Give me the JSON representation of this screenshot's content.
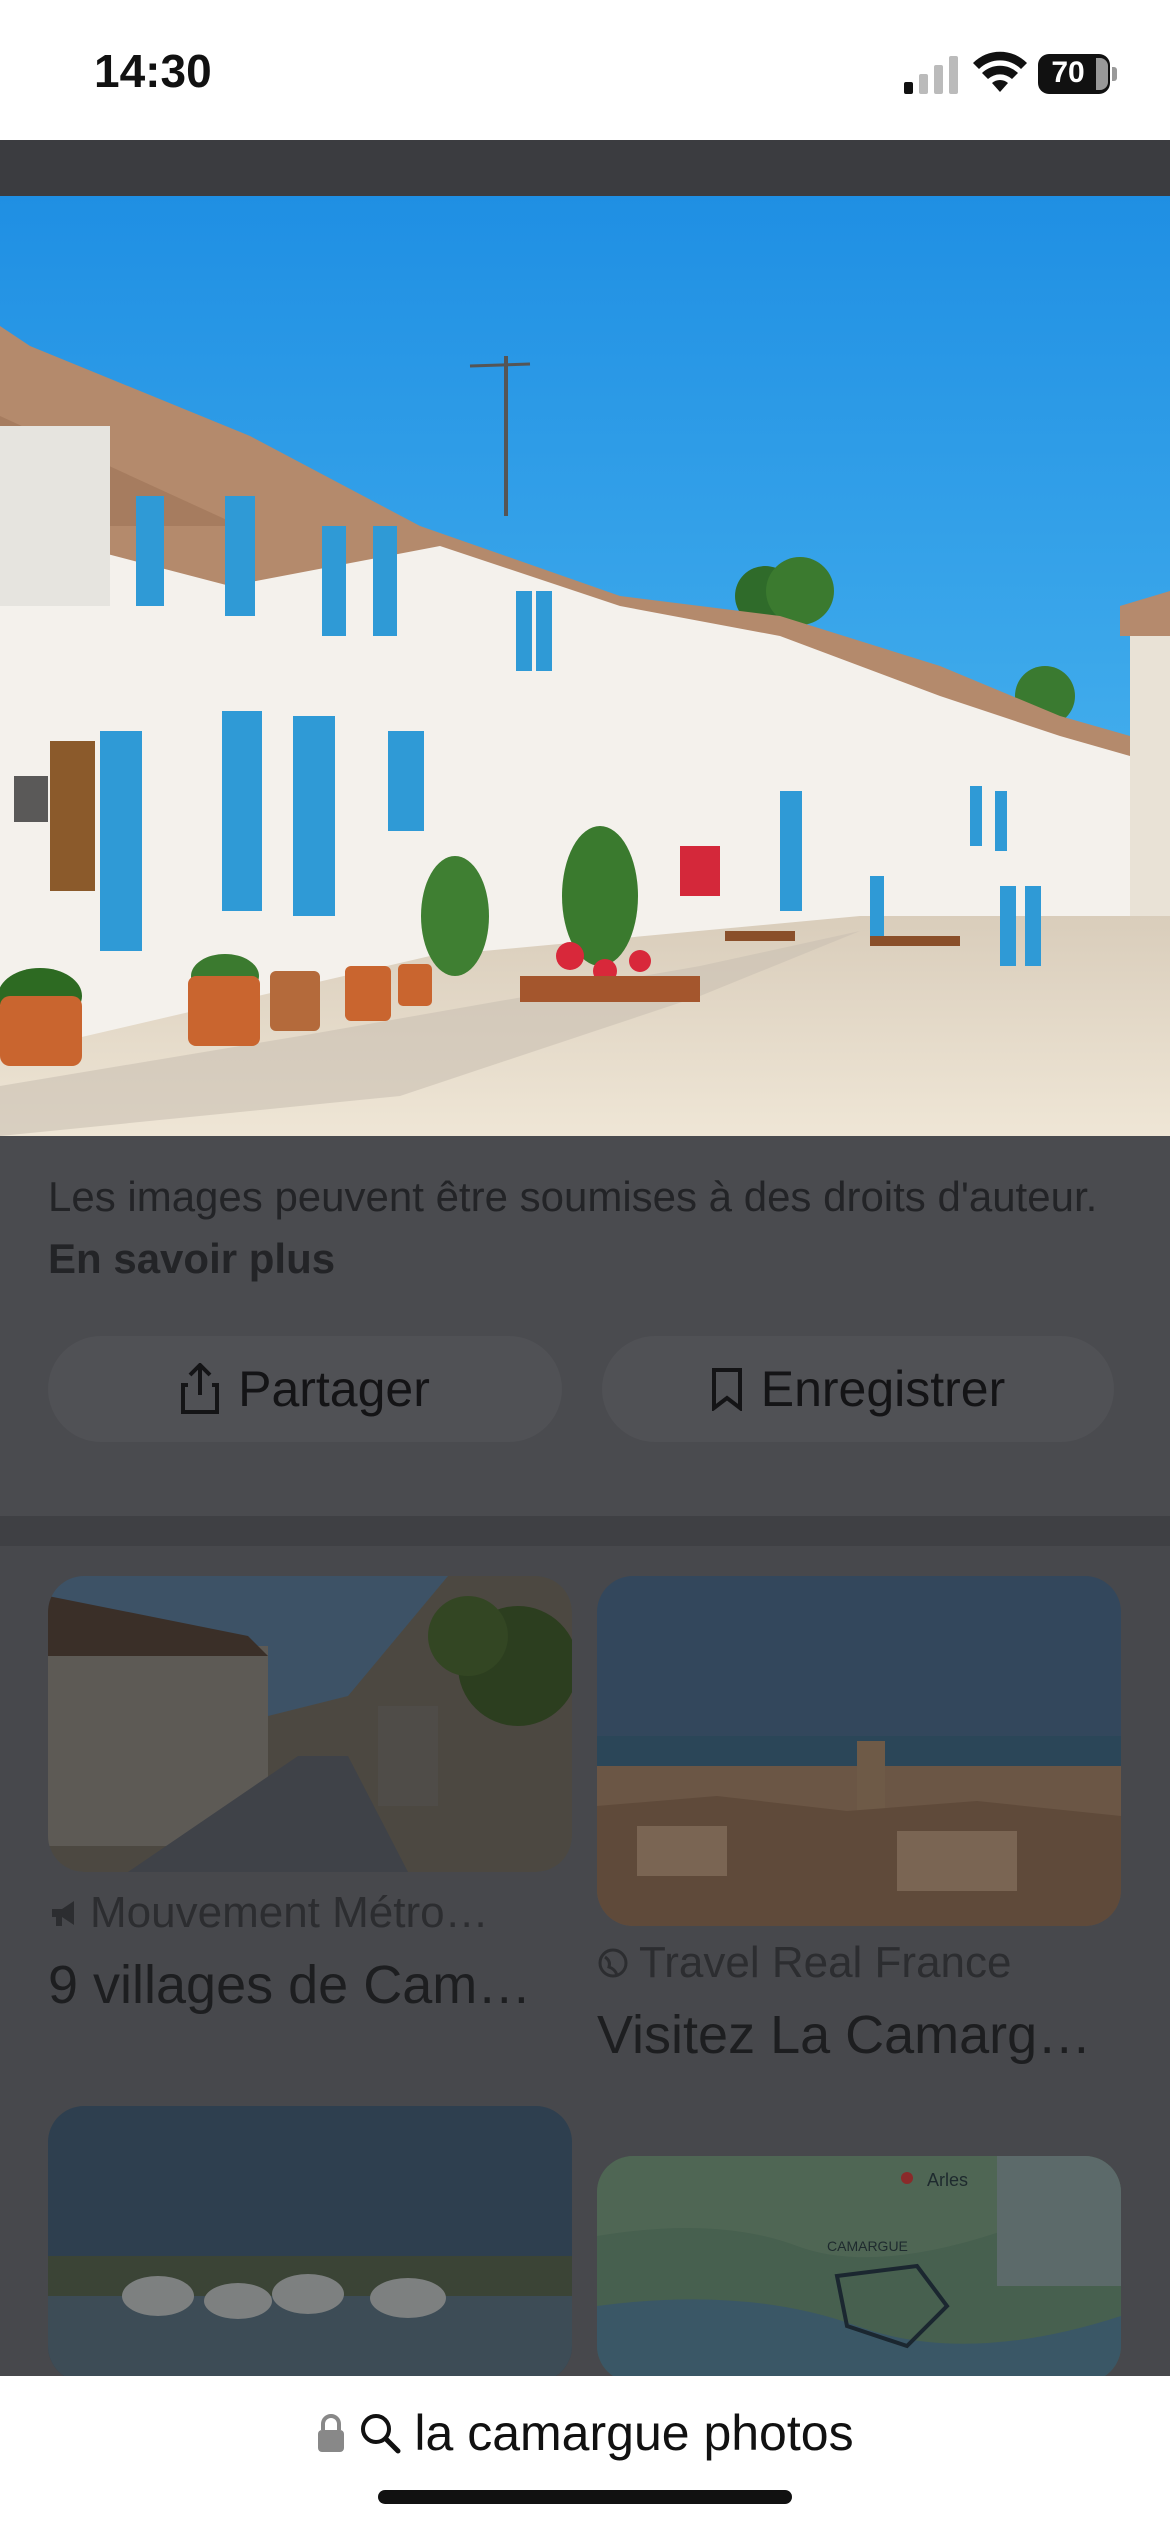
{
  "status": {
    "time": "14:30",
    "battery": "70"
  },
  "viewer": {
    "copyright_text": "Les images peuvent être soumises à des droits d'auteur.",
    "learn_more": "En savoir plus",
    "share_label": "Partager",
    "save_label": "Enregistrer"
  },
  "related": [
    {
      "source": "Mouvement Métro…",
      "title": "9 villages de Cam…",
      "source_icon": "megaphone-icon"
    },
    {
      "source": "Travel Real France",
      "title": "Visitez La Camarg…",
      "source_icon": "globe-icon"
    }
  ],
  "map_labels": {
    "arles": "Arles",
    "camargue": "CAMARGUE"
  },
  "address_bar": {
    "query": "la camargue photos"
  }
}
